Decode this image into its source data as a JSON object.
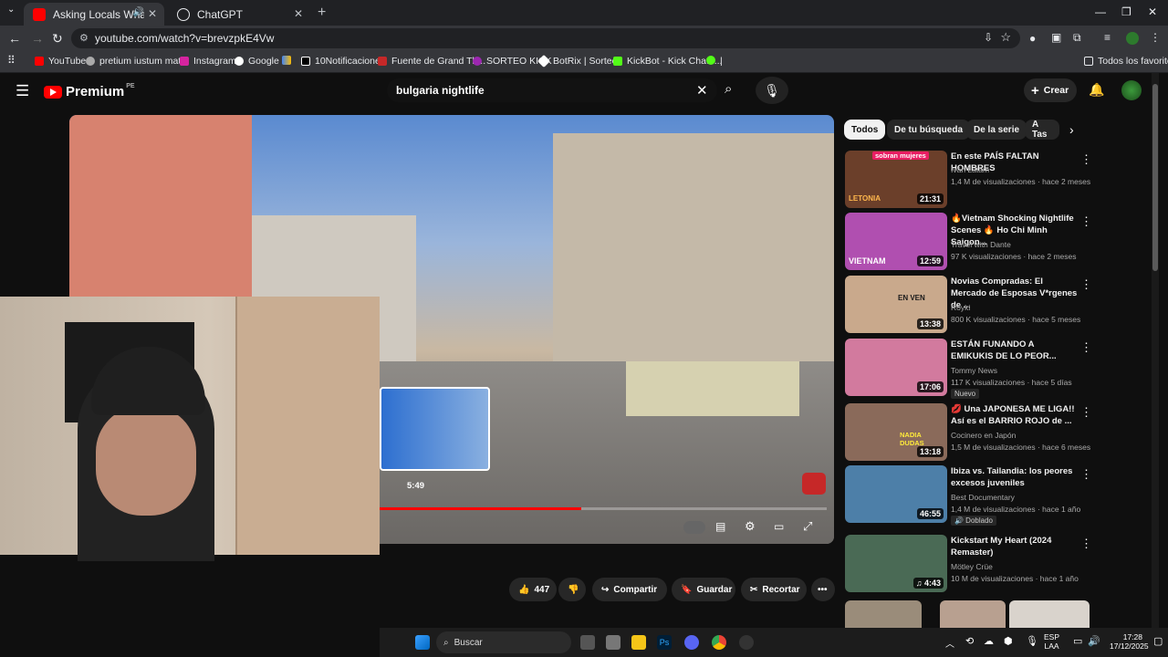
{
  "tabs": [
    {
      "title": "Asking Locals What to Do P",
      "active": true
    },
    {
      "title": "ChatGPT",
      "active": false
    }
  ],
  "url": "youtube.com/watch?v=brevzpkE4Vw",
  "bookmarks": [
    "YouTube",
    "pretium iustum mat...",
    "Instagram",
    "Google",
    "",
    "10Notificaciones",
    "Fuente de Grand Th...",
    "SORTEO KICK",
    "BotRix | Sorteos",
    "KickBot - Kick Chatb...",
    "10",
    "|"
  ],
  "bookmarks_all": "Todos los favoritos",
  "yt": {
    "logo": "Premium",
    "region": "PE",
    "search_value": "bulgaria nightlife",
    "create": "Crear"
  },
  "player": {
    "preview_time": "5:49",
    "progress": 0.45
  },
  "actions": {
    "likes": "447",
    "share": "Compartir",
    "save": "Guardar",
    "clip": "Recortar"
  },
  "chips": [
    "Todos",
    "De tu búsqueda",
    "De la serie",
    "A Tas"
  ],
  "recs": [
    {
      "title": "En este PAÍS FALTAN HOMBRES",
      "channel": "Iván Latam",
      "meta": "1,4 M de visualizaciones · hace 2 meses",
      "dur": "21:31",
      "overlay": "sobran mujeres",
      "overlay2": "LETONIA",
      "color": "#6b3f2a"
    },
    {
      "title": "🔥Vietnam Shocking Nightlife Scenes 🔥 Ho Chi Minh Saigon...",
      "channel": "Travel with Dante",
      "meta": "97 K visualizaciones · hace 2 meses",
      "dur": "12:59",
      "overlay2": "VIETNAM",
      "color": "#b04fb0"
    },
    {
      "title": "Novias Compradas: El Mercado de Esposas V*rgenes de ...",
      "channel": "Royki",
      "meta": "800 K visualizaciones · hace 5 meses",
      "dur": "13:38",
      "overlay2": "EN VEN",
      "color": "#c9a98c"
    },
    {
      "title": "ESTÁN FUNANDO A EMIKUKIS DE LO PEOR...",
      "channel": "Tommy News",
      "meta": "117 K visualizaciones · hace 5 días",
      "dur": "17:06",
      "badge": "Nuevo",
      "color": "#d27a9e"
    },
    {
      "title": "💋 Una JAPONESA ME LIGA!! Así es el BARRIO ROJO de ...",
      "channel": "Cocinero en Japón",
      "meta": "1,5 M de visualizaciones · hace 6 meses",
      "dur": "13:18",
      "overlay2": "NADIA DUDAS",
      "color": "#8a6a5a"
    },
    {
      "title": "Ibiza vs. Tailandia: los peores excesos juveniles",
      "channel": "Best Documentary",
      "meta": "1,4 M de visualizaciones · hace 1 año",
      "dur": "46:55",
      "badge": "🔊 Doblado",
      "color": "#4d7fa8"
    },
    {
      "title": "Kickstart My Heart (2024 Remaster)",
      "channel": "Mötley Crüe",
      "meta": "10 M de visualizaciones · hace 1 año",
      "dur": "♫ 4:43",
      "color": "#4a6a55"
    }
  ],
  "taskbar": {
    "search": "Buscar",
    "lang1": "ESP",
    "lang2": "LAA",
    "time": "17:28",
    "date": "17/12/2025"
  }
}
